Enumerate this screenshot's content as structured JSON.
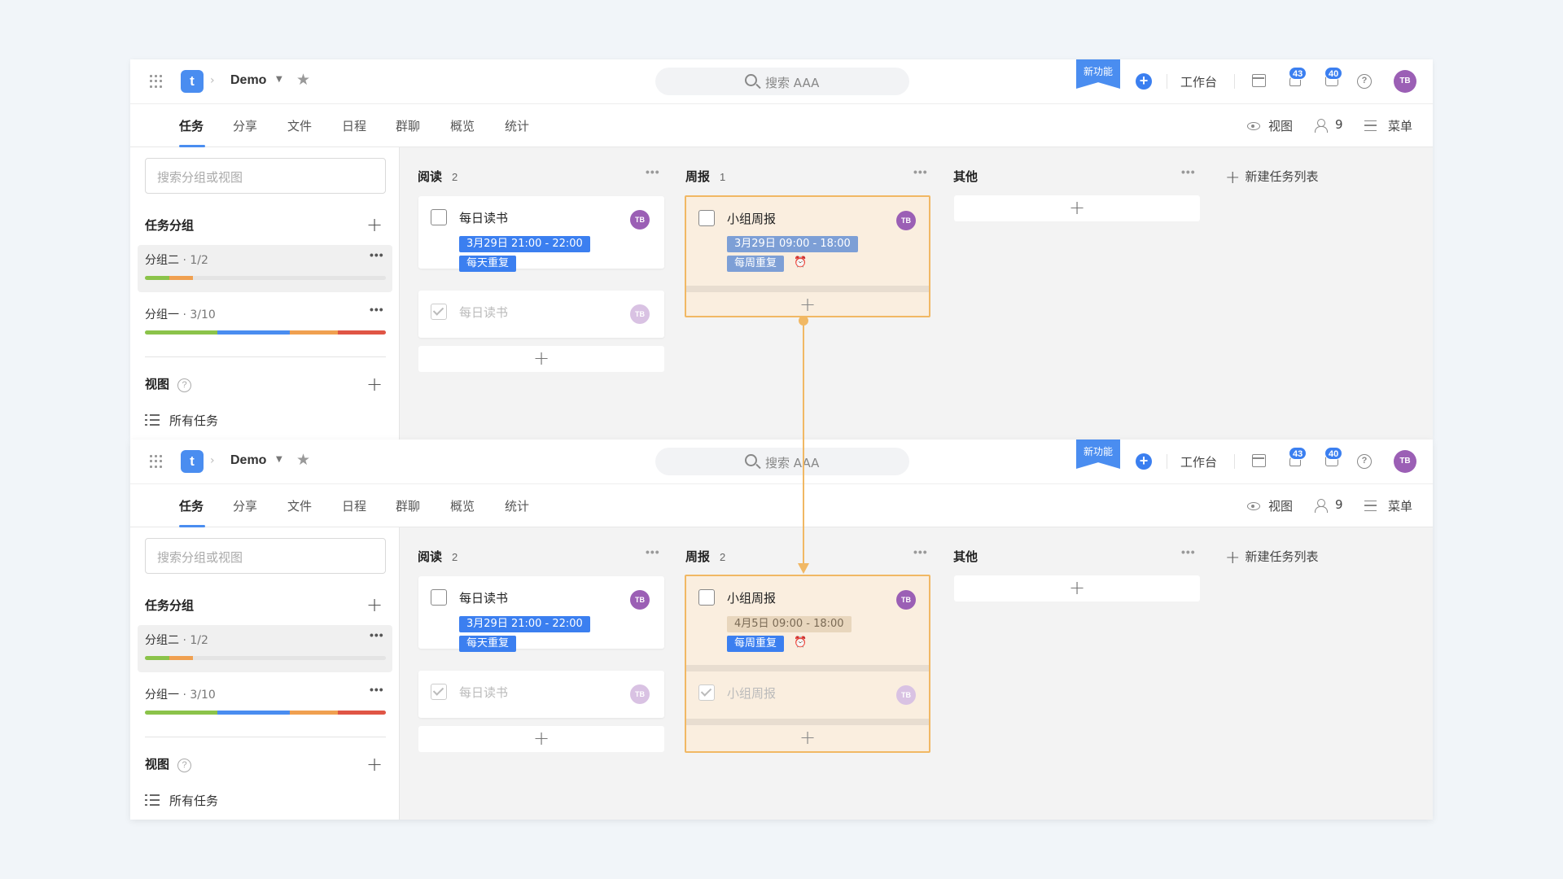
{
  "topbar": {
    "project": "Demo",
    "search_text": "搜索 AAA",
    "new_feature": "新功能",
    "workbench": "工作台",
    "notifications_count": "43",
    "messages_count": "40",
    "avatar": "TB"
  },
  "tabs": [
    "任务",
    "分享",
    "文件",
    "日程",
    "群聊",
    "概览",
    "统计"
  ],
  "toolbar": {
    "view": "视图",
    "members": "9",
    "menu": "菜单"
  },
  "sidebar": {
    "search_placeholder": "搜索分组或视图",
    "groups_heading": "任务分组",
    "groups": [
      {
        "name": "分组二",
        "count": " · 1/2"
      },
      {
        "name": "分组一",
        "count": " · 3/10"
      }
    ],
    "views_heading": "视图",
    "all_tasks": "所有任务"
  },
  "progress_colors": {
    "green": "#8bc34a",
    "orange": "#f0a050",
    "blue": "#4a8df0",
    "red": "#e05545",
    "track": "#e4e4e4"
  },
  "progress_segments": {
    "group2": [
      [
        "green",
        0.1
      ],
      [
        "orange",
        0.1
      ]
    ],
    "group1": [
      [
        "green",
        0.3
      ],
      [
        "blue",
        0.3
      ],
      [
        "orange",
        0.2
      ],
      [
        "red",
        0.2
      ]
    ]
  },
  "columns_before": {
    "reading": {
      "name": "阅读",
      "count": "2"
    },
    "weekly": {
      "name": "周报",
      "count": "1"
    },
    "other": {
      "name": "其他"
    },
    "new_list": "新建任务列表"
  },
  "columns_after": {
    "reading": {
      "name": "阅读",
      "count": "2"
    },
    "weekly": {
      "name": "周报",
      "count": "2"
    },
    "other": {
      "name": "其他"
    },
    "new_list": "新建任务列表"
  },
  "tasks": {
    "reading_title": "每日读书",
    "reading_time": "3月29日 21:00 - 22:00",
    "reading_repeat": "每天重复",
    "weekly_title": "小组周报",
    "weekly_time_before": "3月29日 09:00 - 18:00",
    "weekly_time_after": "4月5日 09:00 - 18:00",
    "weekly_repeat": "每周重复",
    "avatar": "TB"
  },
  "colors": {
    "accent": "#4a8df0",
    "highlight_border": "#f1b864",
    "highlight_bg": "#faeedf",
    "avatar": "#9b5fb5"
  }
}
